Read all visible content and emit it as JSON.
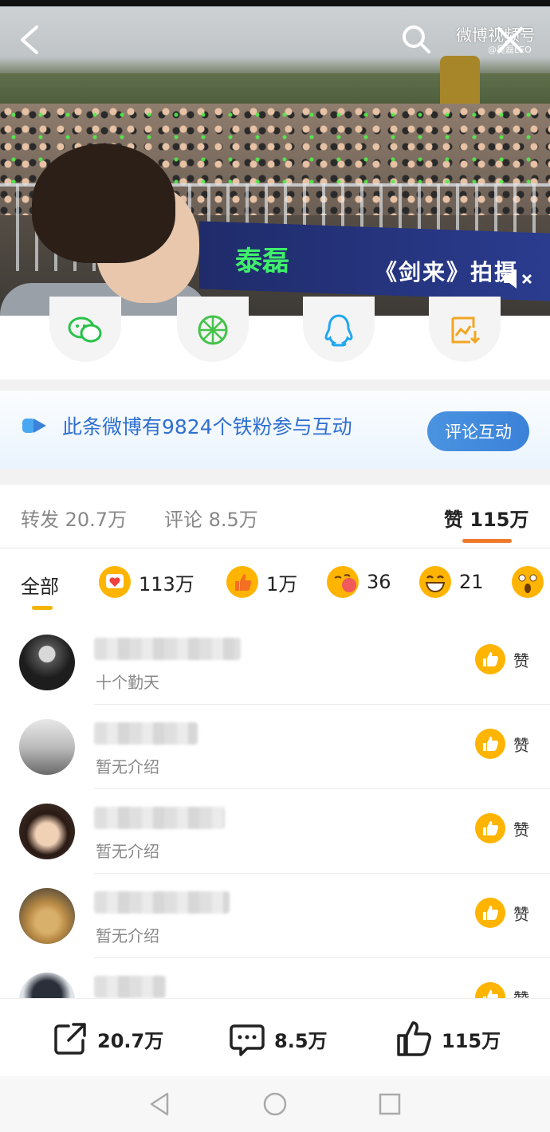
{
  "video": {
    "watermark_title": "微博视频号",
    "watermark_sub": "@吴磊LEO",
    "banner_green": "泰磊",
    "banner_text": "《剑来》拍摄"
  },
  "fan_banner": {
    "text": "此条微博有9824个铁粉参与互动",
    "button": "评论互动"
  },
  "tabs": [
    {
      "label": "转发 20.7万"
    },
    {
      "label": "评论 8.5万"
    },
    {
      "label": "赞 115万"
    }
  ],
  "reactions": {
    "all_label": "全部",
    "items": [
      {
        "count": "113万",
        "icon": "heart-emoji"
      },
      {
        "count": "1万",
        "icon": "thumbs-up-emoji"
      },
      {
        "count": "36",
        "icon": "kiss-emoji"
      },
      {
        "count": "21",
        "icon": "grin-emoji"
      }
    ]
  },
  "likers": [
    {
      "desc": "十个勤天",
      "like_label": "赞"
    },
    {
      "desc": "暂无介绍",
      "like_label": "赞"
    },
    {
      "desc": "暂无介绍",
      "like_label": "赞"
    },
    {
      "desc": "暂无介绍",
      "like_label": "赞"
    },
    {
      "desc": "",
      "like_label": "赞"
    }
  ],
  "actions": {
    "repost_count": "20.7万",
    "comment_count": "8.5万",
    "like_count": "115万"
  },
  "colors": {
    "accent_orange": "#f07a2c",
    "link_blue": "#2f6fd0",
    "button_blue": "#3b82d9",
    "like_yellow": "#ffb400"
  }
}
